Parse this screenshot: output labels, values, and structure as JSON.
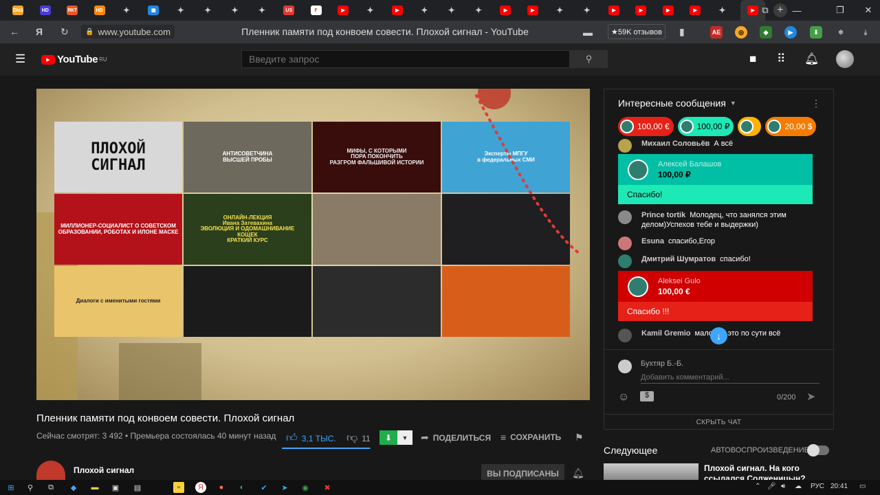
{
  "browser": {
    "url": "www.youtube.com",
    "page_title": "Пленник памяти под конвоем совести. Плохой сигнал - YouTube",
    "reviews_button": "★59K отзывов",
    "yandex_label": "Я",
    "tabs": [
      {
        "icon": "dns-favicon",
        "label": "DNS",
        "color": "#f5a623"
      },
      {
        "icon": "hd-favicon",
        "label": "HD",
        "color": "#4b3bd6"
      },
      {
        "icon": "tab-favicon",
        "label": "ЯКТ",
        "color": "#e8572a"
      },
      {
        "icon": "hd-orange-favicon",
        "label": "HD",
        "color": "#ff8a00"
      },
      {
        "icon": "sparkle-icon",
        "label": "✦",
        "color": ""
      },
      {
        "icon": "page-favicon",
        "label": "▦",
        "color": "#1e88e5"
      },
      {
        "icon": "sparkle-icon",
        "label": "✦",
        "color": ""
      },
      {
        "icon": "sparkle-icon",
        "label": "✦",
        "color": ""
      },
      {
        "icon": "sparkle-icon",
        "label": "✦",
        "color": ""
      },
      {
        "icon": "sparkle-icon",
        "label": "✦",
        "color": ""
      },
      {
        "icon": "us-favicon",
        "label": "US",
        "color": "#e53935"
      },
      {
        "icon": "f-favicon",
        "label": "F",
        "color": "#fff"
      },
      {
        "icon": "youtube-icon",
        "label": "▶",
        "color": "#ff0000"
      },
      {
        "icon": "sparkle-icon",
        "label": "✦",
        "color": ""
      },
      {
        "icon": "youtube-icon",
        "label": "▶",
        "color": "#ff0000"
      },
      {
        "icon": "sparkle-icon",
        "label": "✦",
        "color": ""
      },
      {
        "icon": "sparkle-icon",
        "label": "✦",
        "color": ""
      },
      {
        "icon": "sparkle-icon",
        "label": "✦",
        "color": ""
      },
      {
        "icon": "youtube-icon",
        "label": "▶",
        "color": "#ff0000"
      },
      {
        "icon": "youtube-icon",
        "label": "▶",
        "color": "#ff0000"
      },
      {
        "icon": "sparkle-icon",
        "label": "✦",
        "color": ""
      },
      {
        "icon": "sparkle-icon",
        "label": "✦",
        "color": ""
      },
      {
        "icon": "youtube-icon",
        "label": "▶",
        "color": "#ff0000"
      },
      {
        "icon": "youtube-icon",
        "label": "▶",
        "color": "#ff0000"
      },
      {
        "icon": "youtube-icon",
        "label": "▶",
        "color": "#ff0000"
      },
      {
        "icon": "youtube-icon",
        "label": "▶",
        "color": "#ff0000"
      },
      {
        "icon": "sparkle-icon",
        "label": "✦",
        "color": ""
      },
      {
        "icon": "youtube-icon",
        "label": "▶",
        "color": "#ff0000",
        "active": true
      }
    ]
  },
  "header": {
    "logo_text": "YouTube",
    "logo_region": "RU",
    "search_placeholder": "Введите запрос"
  },
  "video": {
    "title": "Пленник памяти под конвоем совести. Плохой сигнал",
    "meta": "Сейчас смотрят: 3 492 • Премьера состоялась 40 минут назад",
    "likes": "3,1 ТЫС.",
    "dislikes": "11",
    "likes_ratio": 0.99,
    "share_label": "ПОДЕЛИТЬСЯ",
    "save_label": "СОХРАНИТЬ",
    "channel_name": "Плохой сигнал",
    "subscribed_label": "ВЫ ПОДПИСАНЫ",
    "thumbnails": [
      {
        "text": "ПЛОХОЙ\nСИГНАЛ",
        "bg": "#d8d8d8",
        "fg": "#111"
      },
      {
        "text": "АНТИСОВЕТЧИНА\nВЫСШЕЙ ПРОБЫ",
        "bg": "#6d6a5d",
        "fg": "#fff"
      },
      {
        "text": "МИФЫ, С КОТОРЫМИ\nПОРА ПОКОНЧИТЬ\nРАЗГРОМ ФАЛЬШИВОЙ ИСТОРИИ",
        "bg": "#3a0d0d",
        "fg": "#eee"
      },
      {
        "text": "Эксперты МПГУ\nв федеральных СМИ",
        "bg": "#3fa3d4",
        "fg": "#fff"
      },
      {
        "text": "МИЛЛИОНЕР-СОЦИАЛИСТ О СОВЕТСКОМ\nОБРАЗОВАНИИ, РОБОТАХ И ИЛОНЕ МАСКЕ",
        "bg": "#b3121b",
        "fg": "#fff"
      },
      {
        "text": "ОНЛАЙН-ЛЕКЦИЯ\nИвана Затевахина\nЭВОЛЮЦИЯ И ОДОМАШНИВАНИЕ\nКОШЕК\nКРАТКИЙ КУРС",
        "bg": "#2b3f1d",
        "fg": "#f4e04d"
      },
      {
        "text": "",
        "bg": "#8a7b67",
        "fg": "#fff"
      },
      {
        "text": "",
        "bg": "#1f1f22",
        "fg": "#fff"
      },
      {
        "text": "Диалоги с именитыми гостями",
        "bg": "#e9c46a",
        "fg": "#222"
      },
      {
        "text": "",
        "bg": "#1b1b1b",
        "fg": "#fff"
      },
      {
        "text": "",
        "bg": "#2c2c2c",
        "fg": "#fff"
      },
      {
        "text": "",
        "bg": "#d75e1a",
        "fg": "#fff"
      }
    ]
  },
  "chat": {
    "header": "Интересные сообщения",
    "hide_label": "СКРЫТЬ ЧАТ",
    "chips": [
      {
        "amount": "100,00 €",
        "color": "#e62117"
      },
      {
        "amount": "100,00 ₽",
        "color": "#1de9b6",
        "fg": "#000"
      },
      {
        "amount": "",
        "color": "#ffb300"
      },
      {
        "amount": "20,00 $",
        "color": "#f57c00"
      }
    ],
    "messages": [
      {
        "author": "Михаил Соловьёв",
        "text": "А всё",
        "avatar_color": "#b8a24a"
      },
      {
        "author": "Prince tortik",
        "text": "Молодец, что занялся этим делом)Успехов тебе и выдержки)",
        "avatar_color": "#8a8a8a"
      },
      {
        "author": "Esuna",
        "text": "спасибо,Егор",
        "avatar_color": "#c77"
      },
      {
        "author": "Дмитрий Шумратов",
        "text": "спасибо!",
        "avatar_color": "#2f7d6f"
      },
      {
        "author": "Kamil Gremio",
        "text": "мало, но это по сути всё",
        "avatar_color": "#555"
      }
    ],
    "superchats": [
      {
        "author": "Алексей Балашов",
        "amount": "100,00 ₽",
        "text": "Спасибо!",
        "top": "#00bfa5",
        "bottom": "#1de9b6"
      },
      {
        "author": "Aleksei Gulo",
        "amount": "100,00 €",
        "text": "Спасибо !!!",
        "top": "#d00000",
        "bottom": "#e62117"
      }
    ],
    "composer_user": "Бухтяр Б.-Б.",
    "composer_placeholder": "Добавить комментарий...",
    "char_counter": "0/200"
  },
  "upnext": {
    "label": "Следующее",
    "autoplay_label": "АВТОВОСПРОИЗВЕДЕНИЕ",
    "next_title": "Плохой сигнал. На кого ссылался Солженицын?"
  },
  "taskbar": {
    "lang": "РУС",
    "time": "20:41"
  }
}
